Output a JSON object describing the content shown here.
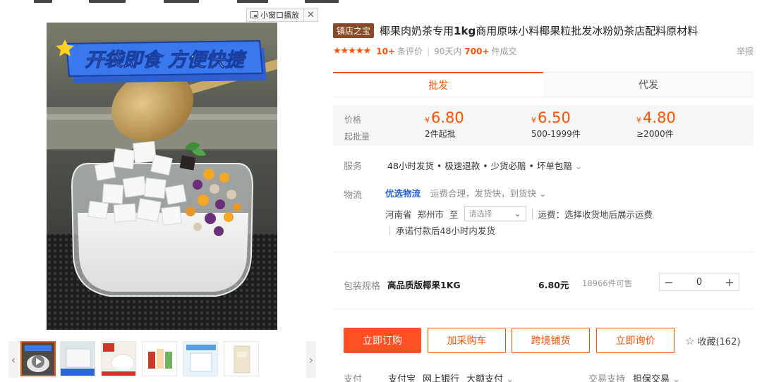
{
  "mini_window": {
    "label": "小窗口播放"
  },
  "product": {
    "store_badge": "镇店之宝",
    "title_pre": "椰果肉奶茶专用",
    "title_bold": "1kg",
    "title_post": "商用原味小料椰果粒批发冰粉奶茶店配料原材料",
    "rating_stars": 5,
    "review_count": "10+",
    "review_label": "条评价",
    "sales_period": "90天内",
    "sales_count": "700+",
    "sales_label": "件成交",
    "report": "举报"
  },
  "image": {
    "banner_text": "开袋即食 方便快捷",
    "thumbnail_count": 6
  },
  "tabs": [
    {
      "label": "批发",
      "active": true
    },
    {
      "label": "代发",
      "active": false
    }
  ],
  "pricing": {
    "price_label": "价格",
    "moq_label": "起批量",
    "currency": "¥",
    "tiers": [
      {
        "price": "6.80",
        "qty": "2件起批"
      },
      {
        "price": "6.50",
        "qty": "500-1999件"
      },
      {
        "price": "4.80",
        "qty": "≥2000件"
      }
    ]
  },
  "service": {
    "label": "服务",
    "text": "48小时发货 • 极速退款 • 少货必赔 • 坏单包赔"
  },
  "logistics": {
    "label": "物流",
    "best": "优选物流",
    "desc": "运费合理，发货快，到货快",
    "province": "河南省",
    "city": "郑州市",
    "to": "至",
    "select_placeholder": "请选择",
    "freight": "运费：选择收货地后展示运费",
    "promise": "承诺付款后48小时内发货"
  },
  "package": {
    "label": "包装规格",
    "name": "高品质版椰果1KG",
    "price": "6.80元",
    "stock": "18966件可售",
    "quantity": "0"
  },
  "actions": {
    "buy_now": "立即订购",
    "add_cart": "加采购车",
    "cross_border": "跨境铺货",
    "inquiry": "立即询价",
    "favorite": "收藏(162)"
  },
  "payment": {
    "label": "支付",
    "methods": [
      "支付宝",
      "网上银行",
      "大额支付"
    ],
    "trade_label": "交易支持",
    "trade_value": "担保交易"
  },
  "colors": {
    "accent": "#ff5000",
    "store_badge": "#8a4a26",
    "logistics_blue": "#2a60d8"
  }
}
